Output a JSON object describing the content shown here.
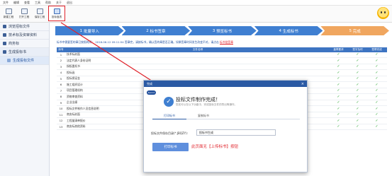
{
  "menu": [
    "文件",
    "编辑",
    "查看",
    "工具",
    "帮助",
    "关于",
    "退出"
  ],
  "toolbar": {
    "items": [
      {
        "label": "新建工程",
        "icon": "new-project-icon"
      },
      {
        "label": "打开工程",
        "icon": "open-project-icon"
      },
      {
        "label": "保存工程",
        "icon": "save-project-icon"
      },
      {
        "label": "投标盘表",
        "icon": "bid-disk-icon"
      }
    ],
    "highlighted_index": 3
  },
  "sidebar": {
    "items": [
      {
        "label": "浏览招标文件"
      },
      {
        "label": "技术标及资审资料"
      },
      {
        "label": "商务标"
      },
      {
        "label": "生成投标书"
      },
      {
        "label": "生成投标文件"
      }
    ]
  },
  "steps": [
    {
      "num": "1",
      "label": "批量导入"
    },
    {
      "num": "2",
      "label": "标书签章"
    },
    {
      "num": "3",
      "label": "预览标书"
    },
    {
      "num": "4",
      "label": "生成标书"
    },
    {
      "num": "5",
      "label": "完成"
    }
  ],
  "notice": {
    "text": "标书中需要签的章已按照时间： 2018-06-12 09:11:54 签章完，请按标书，确认签的章是否正确。如果签章时间发生改变不对，请点击",
    "link": "标书批签章"
  },
  "table": {
    "headers": [
      "序号",
      "文件名称",
      "盖章要求",
      "签字及时",
      "签章完成"
    ],
    "rows": [
      {
        "no": "1",
        "name": "技术标封面"
      },
      {
        "no": "2",
        "name": "法定代表人身份证明"
      },
      {
        "no": "3",
        "name": "授权委托书"
      },
      {
        "no": "4",
        "name": "投标函"
      },
      {
        "no": "5",
        "name": "投标保证金"
      },
      {
        "no": "6",
        "name": "施工组织设计"
      },
      {
        "no": "7",
        "name": "项目管理机构"
      },
      {
        "no": "8",
        "name": "资格审查资料"
      },
      {
        "no": "9",
        "name": "企业业绩"
      },
      {
        "no": "10",
        "name": "投标文件制作人员信息说明"
      },
      {
        "no": "11",
        "name": "商务标封面"
      },
      {
        "no": "12",
        "name": "工程量清单报价"
      },
      {
        "no": "13",
        "name": "商务标其他资料"
      }
    ],
    "check": "✓"
  },
  "dialog": {
    "title": "完成",
    "logo": "Epoint",
    "close": "×",
    "heading": "投标文件制作完成！",
    "subtitle": "您还可以在以下功能中，完成投标文件的导出等操作。",
    "tabs": [
      "打印标书",
      "复制标书"
    ],
    "field_label": "投标文件保存目录(*.JBQZY):",
    "field_value": "投标书生成",
    "button_label": "打印标书"
  },
  "hint": "此页面无【上传标书】按钮",
  "colors": {
    "accent": "#3f7fd1",
    "done_step": "#f0a65f",
    "highlight": "#e0232b",
    "check": "#2fa536"
  }
}
